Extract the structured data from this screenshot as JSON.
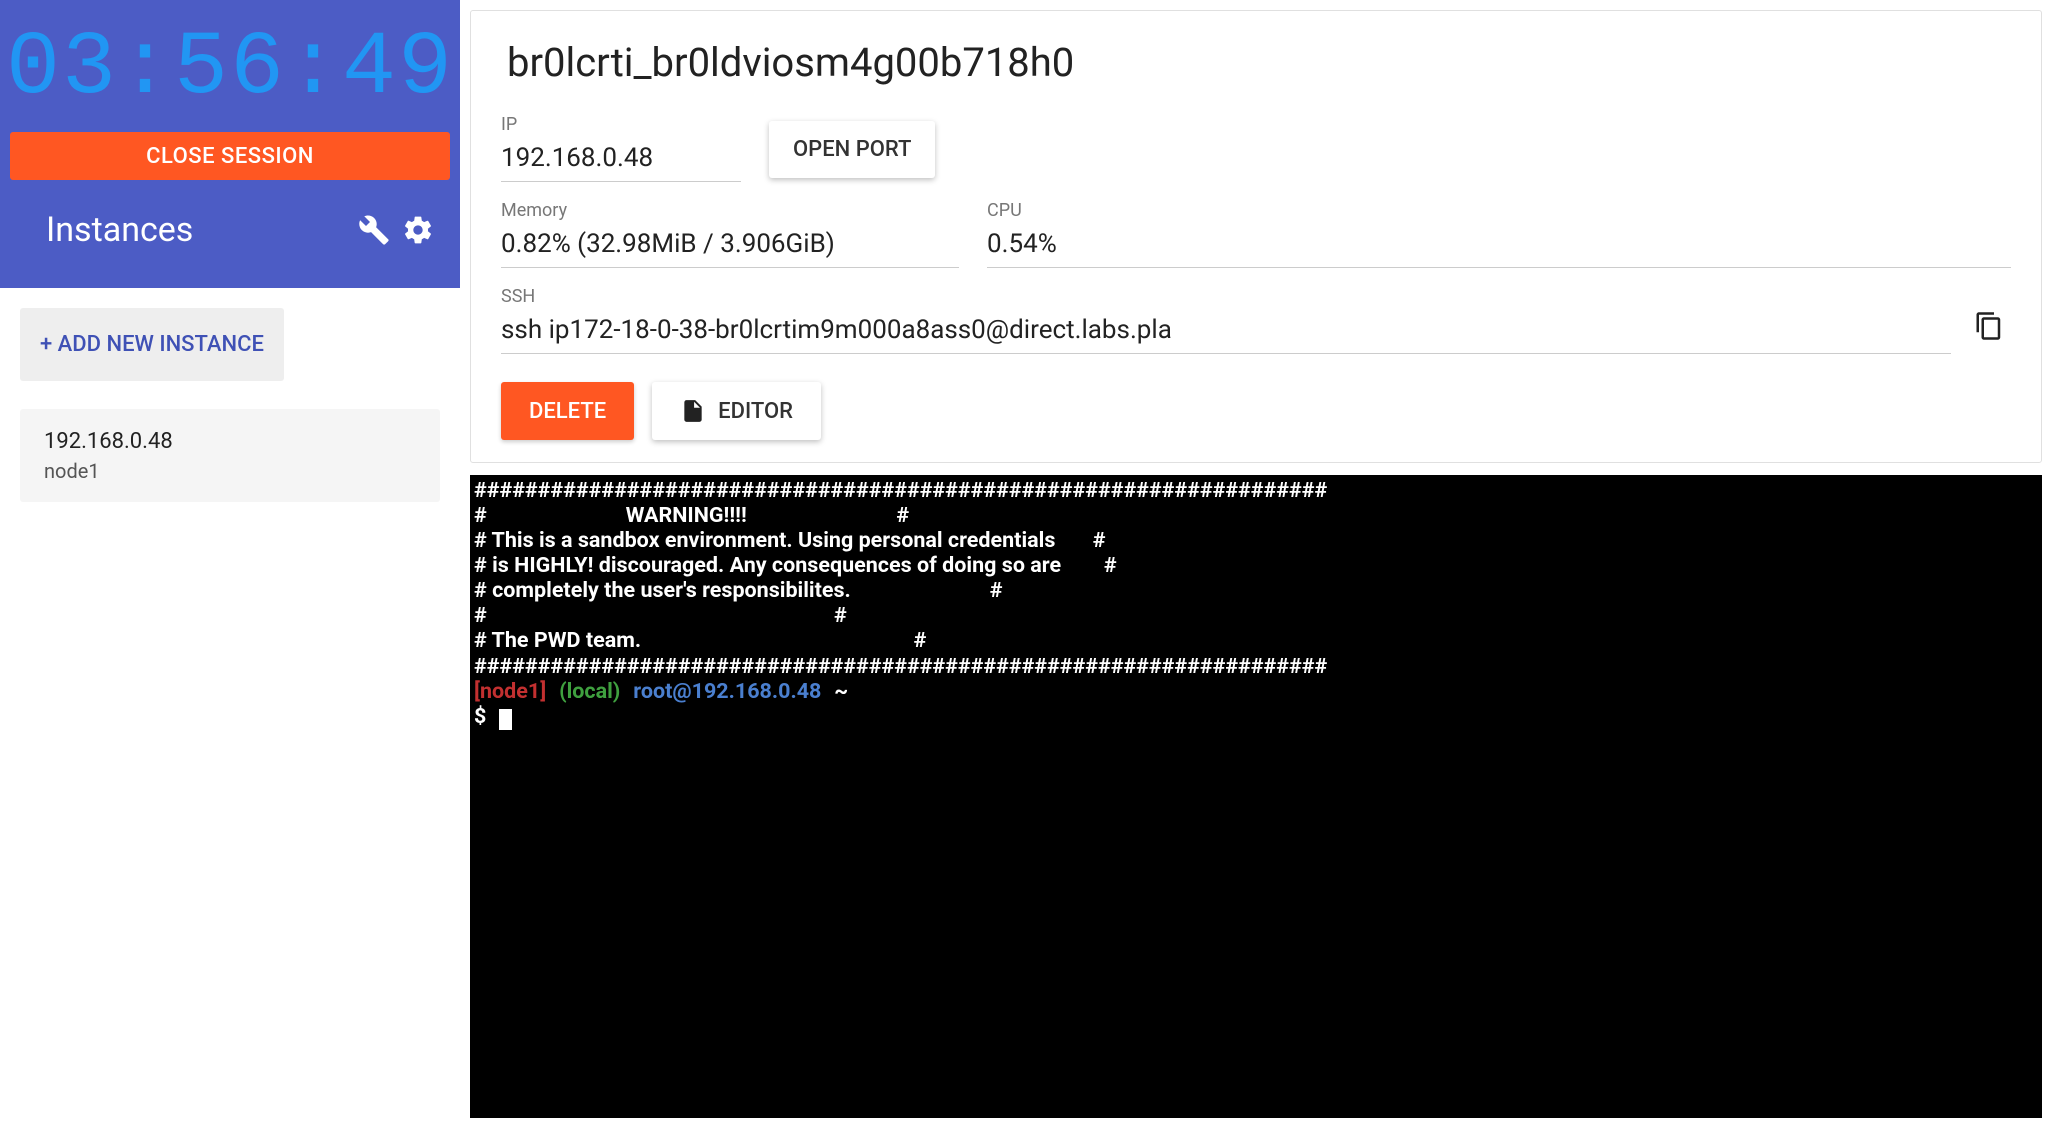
{
  "timer": "03:56:49",
  "sidebar": {
    "close_session_label": "CLOSE SESSION",
    "instances_title": "Instances",
    "add_instance_label": "+ ADD NEW INSTANCE",
    "instances": [
      {
        "ip": "192.168.0.48",
        "name": "node1"
      }
    ]
  },
  "details": {
    "title": "br0lcrti_br0ldviosm4g00b718h0",
    "ip_label": "IP",
    "ip_value": "192.168.0.48",
    "open_port_label": "OPEN PORT",
    "memory_label": "Memory",
    "memory_value": "0.82% (32.98MiB / 3.906GiB)",
    "cpu_label": "CPU",
    "cpu_value": "0.54%",
    "ssh_label": "SSH",
    "ssh_value": "ssh ip172-18-0-38-br0lcrtim9m000a8ass0@direct.labs.pla",
    "delete_label": "DELETE",
    "editor_label": "EDITOR"
  },
  "terminal": {
    "banner": [
      "###################################################################",
      "#                          WARNING!!!!                            #",
      "# This is a sandbox environment. Using personal credentials       #",
      "# is HIGHLY! discouraged. Any consequences of doing so are        #",
      "# completely the user's responsibilites.                          #",
      "#                                                                 #",
      "# The PWD team.                                                   #",
      "###################################################################"
    ],
    "prompt_node": "[node1]",
    "prompt_local": "(local)",
    "prompt_user": "root@192.168.0.48",
    "prompt_path": "~",
    "prompt_symbol": "$"
  }
}
